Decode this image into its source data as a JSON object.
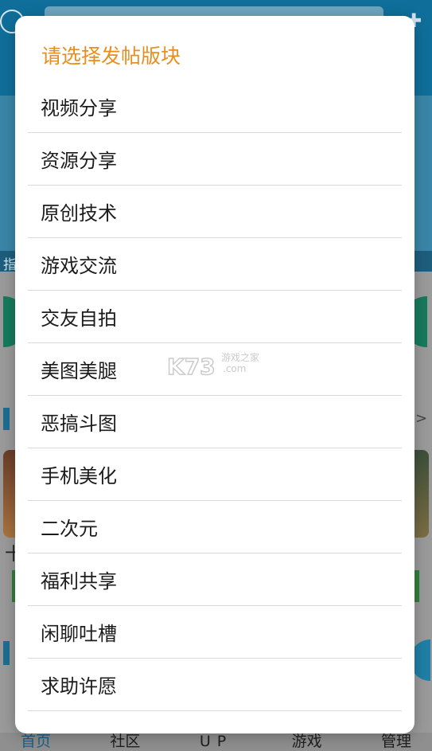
{
  "dialog": {
    "title": "请选择发帖版块",
    "items": [
      {
        "label": "视频分享"
      },
      {
        "label": "资源分享"
      },
      {
        "label": "原创技术"
      },
      {
        "label": "游戏交流"
      },
      {
        "label": "交友自拍"
      },
      {
        "label": "美图美腿"
      },
      {
        "label": "恶搞斗图"
      },
      {
        "label": "手机美化"
      },
      {
        "label": "二次元"
      },
      {
        "label": "福利共享"
      },
      {
        "label": "闲聊吐槽"
      },
      {
        "label": "求助许愿"
      }
    ]
  },
  "background": {
    "notice_text": "指",
    "chevron": ">",
    "plus": "十"
  },
  "tabbar": {
    "tabs": [
      {
        "label": "首页"
      },
      {
        "label": "社区"
      },
      {
        "label": "UP"
      },
      {
        "label": "游戏"
      },
      {
        "label": "管理"
      }
    ]
  },
  "watermark": {
    "brand": "K73",
    "tagline": "游戏之家",
    "domain": ".com"
  },
  "colors": {
    "title_accent": "#e88e1f",
    "header_bg": "#0f6f9a",
    "active_tab": "#1f5f86"
  }
}
